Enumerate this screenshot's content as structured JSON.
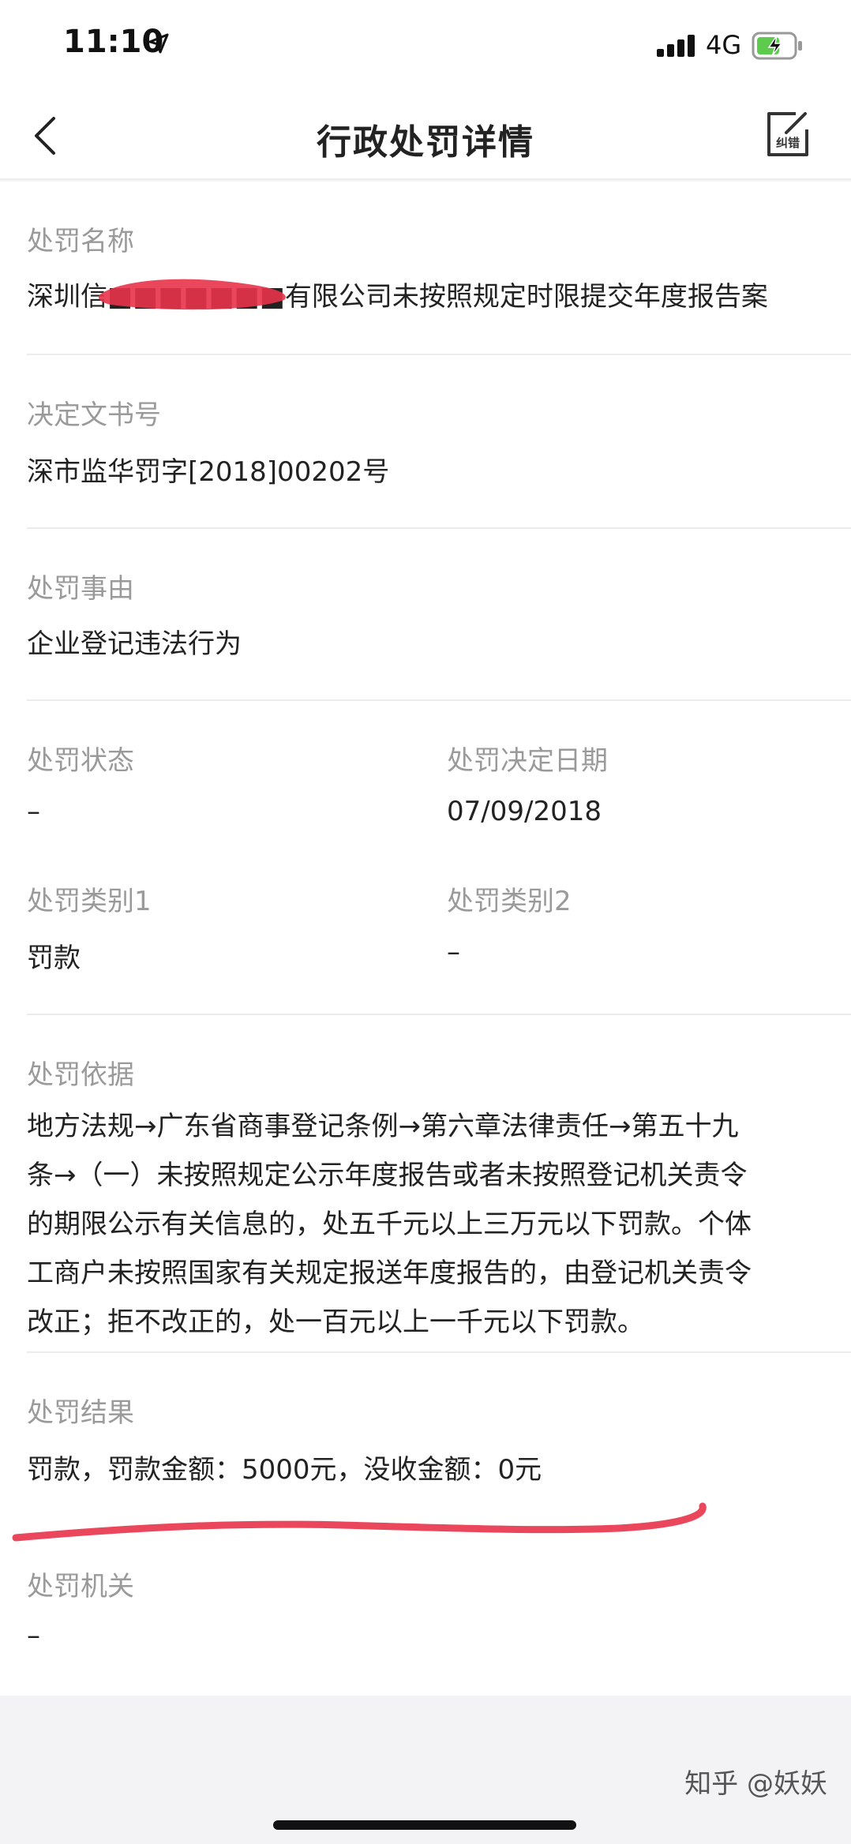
{
  "status_bar": {
    "time": "11:10",
    "network": "4G",
    "icons": [
      "location-arrow-icon",
      "signal-icon",
      "battery-charging-icon"
    ]
  },
  "nav": {
    "title": "行政处罚详情",
    "report_label": "纠错",
    "icons": [
      "chevron-left-icon",
      "edit-report-icon"
    ]
  },
  "fields": {
    "penalty_name": {
      "label": "处罚名称",
      "value": "深圳信■■■■■■■有限公司未按照规定时限提交年度报告案"
    },
    "document_no": {
      "label": "决定文书号",
      "value": "深市监华罚字[2018]00202号"
    },
    "reason": {
      "label": "处罚事由",
      "value": "企业登记违法行为"
    },
    "status": {
      "label": "处罚状态",
      "value": "–"
    },
    "decision_date": {
      "label": "处罚决定日期",
      "value": "07/09/2018"
    },
    "category1": {
      "label": "处罚类别1",
      "value": "罚款"
    },
    "category2": {
      "label": "处罚类别2",
      "value": "–"
    },
    "basis": {
      "label": "处罚依据",
      "lines": [
        "地方法规→广东省商事登记条例→第六章法律责任→第五十九",
        "条→（一）未按照规定公示年度报告或者未按照登记机关责令",
        "的期限公示有关信息的，处五千元以上三万元以下罚款。个体",
        "工商户未按照国家有关规定报送年度报告的，由登记机关责令",
        "改正；拒不改正的，处一百元以上一千元以下罚款。"
      ]
    },
    "result": {
      "label": "处罚结果",
      "value": "罚款，罚款金额：5000元，没收金额：0元"
    },
    "authority": {
      "label": "处罚机关",
      "value": "–"
    }
  },
  "watermark": "知乎 @妖妖",
  "colors": {
    "label_gray": "#9a9a9a",
    "text": "#222222",
    "background": "#f3f3f5",
    "battery_green": "#5ecb4f",
    "marker_red": "#e8334a"
  }
}
